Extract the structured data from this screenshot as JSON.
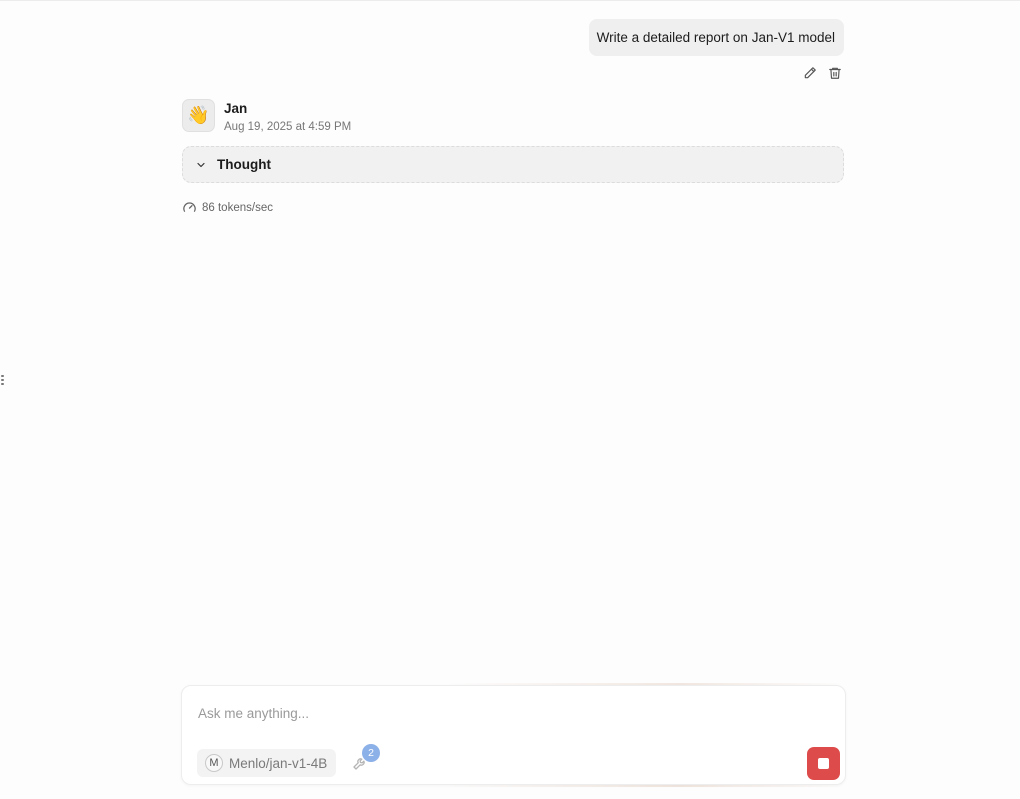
{
  "user_message": {
    "text": "Write a detailed report on Jan-V1 model",
    "actions": {
      "edit_icon": "pencil-icon",
      "delete_icon": "trash-icon"
    }
  },
  "assistant": {
    "name": "Jan",
    "timestamp": "Aug 19, 2025 at 4:59 PM",
    "avatar_icon": "👋",
    "thought": {
      "label": "Thought",
      "icon": "chevron-down-icon"
    },
    "tokens_speed": "86 tokens/sec"
  },
  "composer": {
    "placeholder": "Ask me anything...",
    "model_badge": "M",
    "model_name": "Menlo/jan-v1-4B",
    "tools_count": "2",
    "stop_color": "#dd4b4b"
  }
}
